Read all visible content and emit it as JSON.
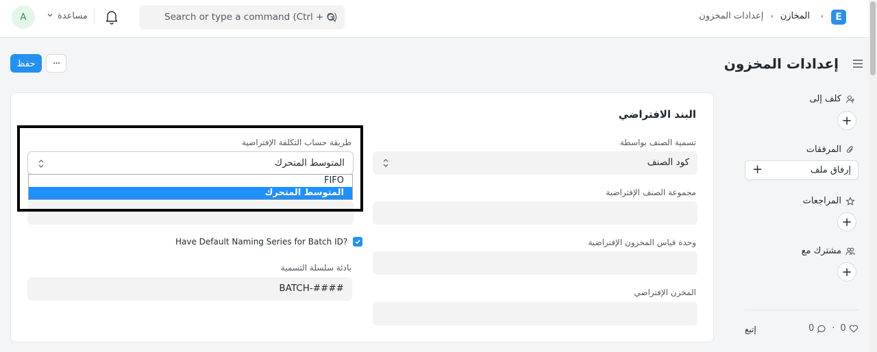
{
  "navbar": {
    "avatar_initial": "A",
    "help_label": "مساعدة",
    "search_placeholder": "Search or type a command (Ctrl + G)",
    "breadcrumb": [
      "المخازن",
      "إعدادات المخزون"
    ],
    "logo_letter": "E"
  },
  "page": {
    "title": "إعدادات المخزون",
    "save_label": "حفظ",
    "more_label": "···"
  },
  "form": {
    "section_title": "البند الافتراضي",
    "fields": {
      "item_naming_by": {
        "label": "تسمية الصنف بواسطة",
        "value": "كود الصنف"
      },
      "default_item_group": {
        "label": "مجموعة الصنف الإفتراضية",
        "value": ""
      },
      "default_stock_uom": {
        "label": "وحدة قياس المخزون الإفتراضية",
        "value": ""
      },
      "default_warehouse": {
        "label": "المخزن الإفتراضي",
        "value": ""
      },
      "valuation_method": {
        "label": "طريقة حساب التكلفة الإفتراضية",
        "value": "المتوسط المتحرك",
        "options": [
          "FIFO",
          "المتوسط المتحرك"
        ],
        "selected_index": 1
      },
      "batch_naming": {
        "label": "Have Default Naming Series for Batch ID?",
        "checked": true
      },
      "naming_prefix": {
        "label": "بادئة سلسلة التسمية",
        "value": "BATCH-####"
      }
    }
  },
  "sidebar": {
    "assign_label": "كلف إلى",
    "attachments_label": "المرفقات",
    "attach_file_label": "إرفاق ملف",
    "reviews_label": "المراجعات",
    "shared_label": "مشترك مع",
    "likes_count": "0",
    "comments_count": "0",
    "follow_label": "إتبع"
  }
}
